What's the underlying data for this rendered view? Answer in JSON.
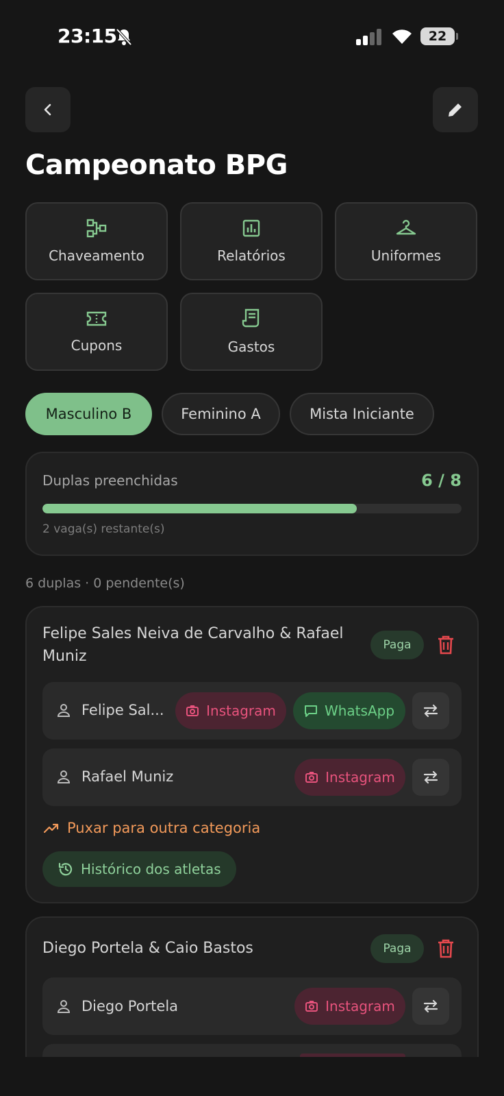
{
  "status_bar": {
    "time": "23:15",
    "battery": "22"
  },
  "header": {
    "title": "Campeonato BPG"
  },
  "tiles": [
    {
      "label": "Chaveamento",
      "icon": "bracket-icon"
    },
    {
      "label": "Relatórios",
      "icon": "chart-icon"
    },
    {
      "label": "Uniformes",
      "icon": "hanger-icon"
    },
    {
      "label": "Cupons",
      "icon": "ticket-icon"
    },
    {
      "label": "Gastos",
      "icon": "receipt-icon"
    }
  ],
  "categories": [
    {
      "label": "Masculino B",
      "active": true
    },
    {
      "label": "Feminino A",
      "active": false
    },
    {
      "label": "Mista Iniciante",
      "active": false
    }
  ],
  "summary": {
    "label": "Duplas preenchidas",
    "count": "6 / 8",
    "filled": 6,
    "total": 8,
    "remaining": "2 vaga(s) restante(s)"
  },
  "list_meta": "6 duplas · 0 pendente(s)",
  "colors": {
    "accent_green": "#7fc08a",
    "instagram": "#e8537d",
    "whatsapp": "#6cd087",
    "delete": "#e5484d",
    "orange": "#f39a5a"
  },
  "pairs": [
    {
      "title": "Felipe Sales Neiva de Carvalho & Rafael Muniz",
      "status": "Paga",
      "athletes": [
        {
          "name": "Felipe Sal...",
          "instagram": "Instagram",
          "whatsapp": "WhatsApp"
        },
        {
          "name": "Rafael Muniz",
          "instagram": "Instagram"
        }
      ],
      "move_link": "Puxar para outra categoria",
      "history": "Histórico dos atletas"
    },
    {
      "title": "Diego Portela & Caio Bastos",
      "status": "Paga",
      "athletes": [
        {
          "name": "Diego Portela",
          "instagram": "Instagram"
        }
      ]
    }
  ]
}
